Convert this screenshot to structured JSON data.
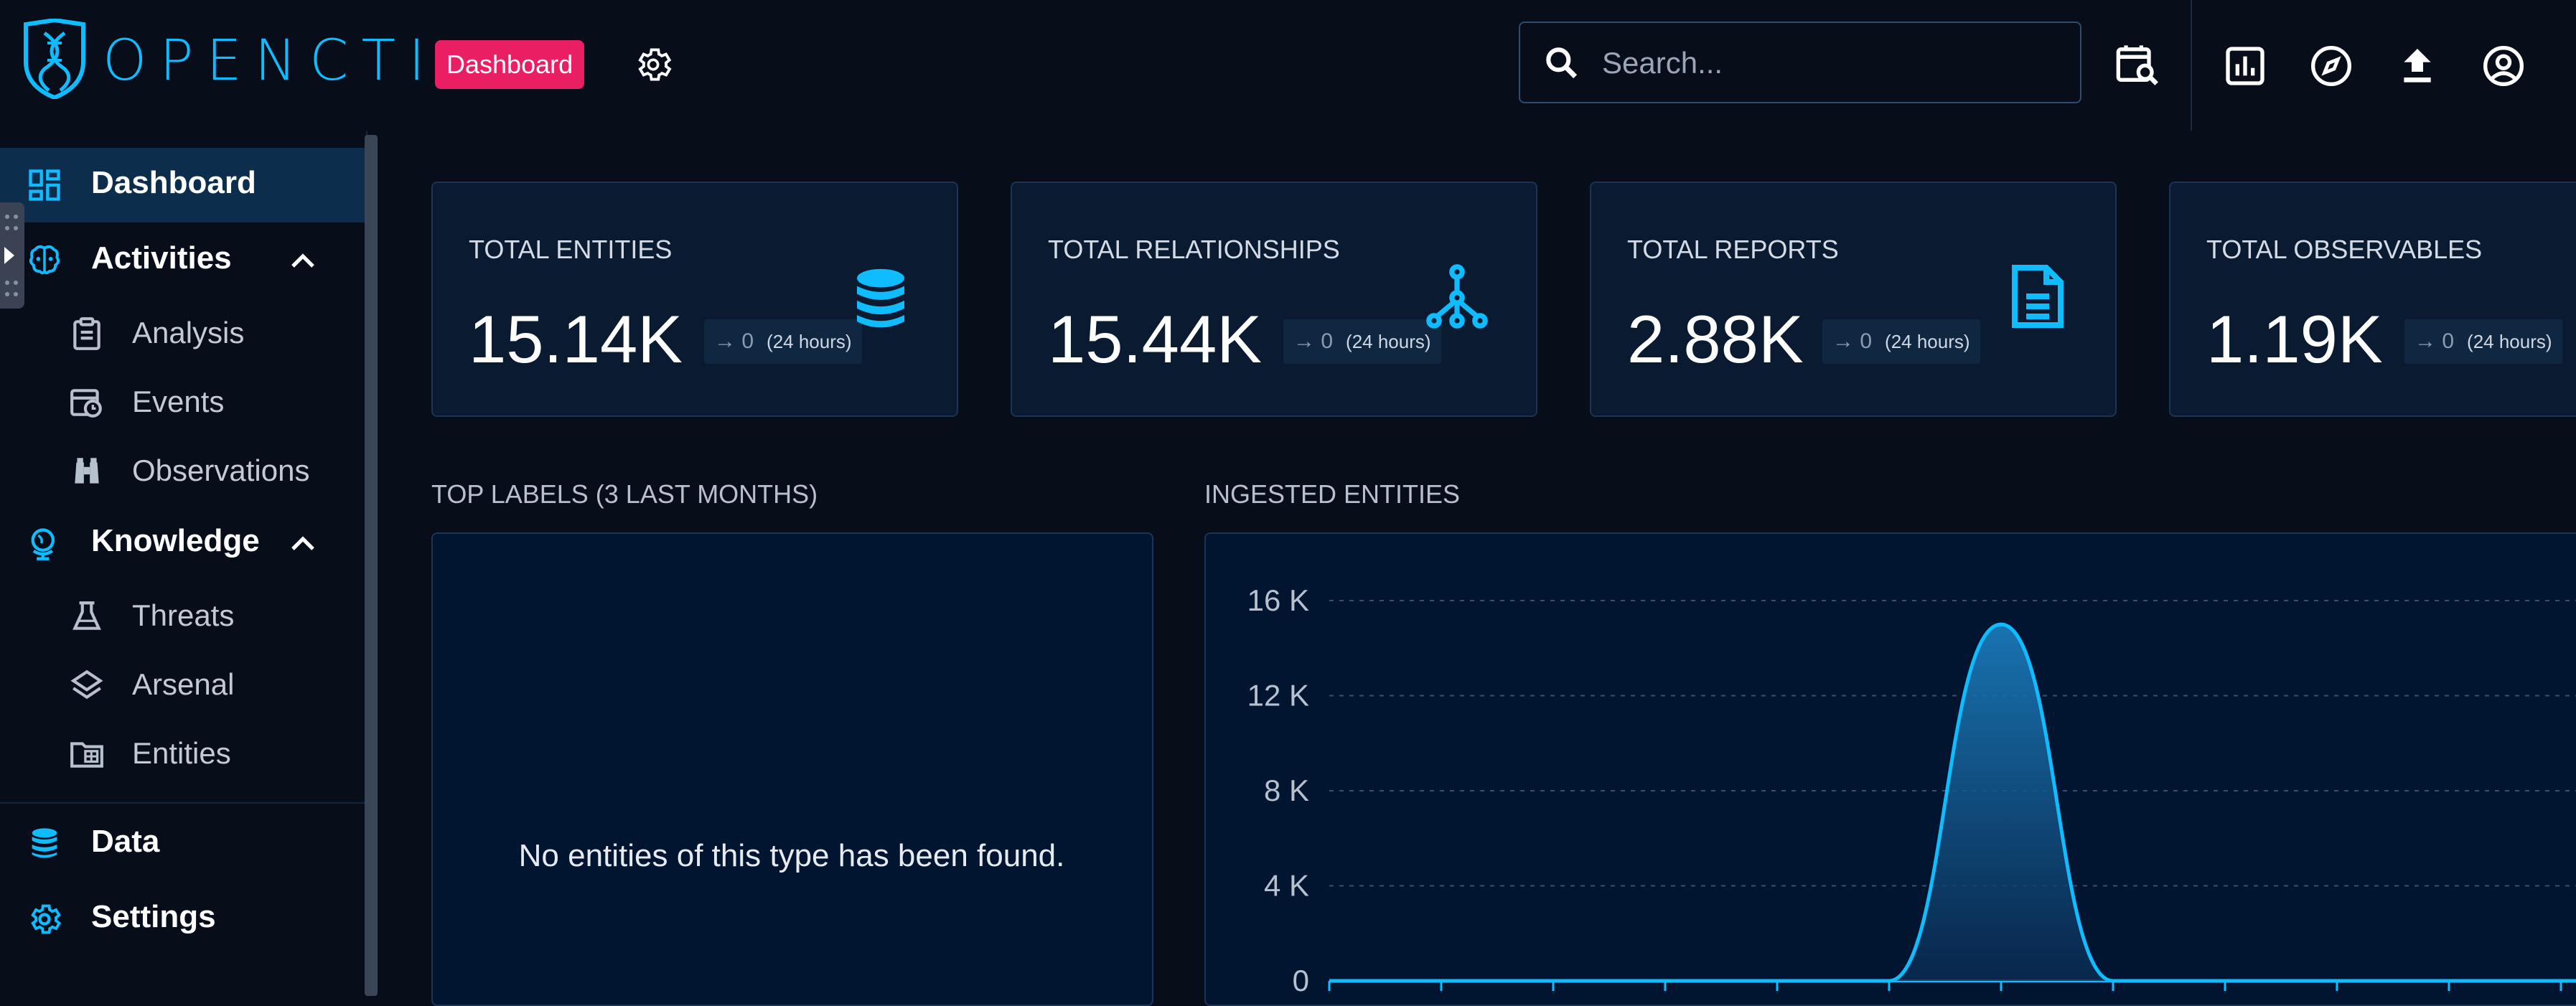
{
  "app": {
    "name": "OPENCTI"
  },
  "header": {
    "page_badge": "Dashboard",
    "search": {
      "placeholder": "Search...",
      "value": ""
    },
    "icons": [
      "settings-icon",
      "search-icon",
      "calendar-search-icon",
      "chart-box-icon",
      "compass-icon",
      "upload-icon",
      "account-icon"
    ]
  },
  "sidebar": {
    "items": [
      {
        "label": "Dashboard",
        "icon": "dashboard-icon",
        "active": true
      },
      {
        "label": "Activities",
        "icon": "brain-icon",
        "expanded": true
      },
      {
        "label": "Analysis",
        "icon": "clipboard-icon"
      },
      {
        "label": "Events",
        "icon": "calendar-clock-icon"
      },
      {
        "label": "Observations",
        "icon": "binoculars-icon"
      },
      {
        "label": "Knowledge",
        "icon": "globe-icon",
        "expanded": true
      },
      {
        "label": "Threats",
        "icon": "flask-icon"
      },
      {
        "label": "Arsenal",
        "icon": "layers-icon"
      },
      {
        "label": "Entities",
        "icon": "folder-table-icon"
      },
      {
        "label": "Data",
        "icon": "database-icon"
      },
      {
        "label": "Settings",
        "icon": "cog-icon"
      }
    ]
  },
  "cards": [
    {
      "title": "TOTAL ENTITIES",
      "value": "15.14K",
      "delta": "0",
      "period": "(24 hours)",
      "icon": "database-icon"
    },
    {
      "title": "TOTAL RELATIONSHIPS",
      "value": "15.44K",
      "delta": "0",
      "period": "(24 hours)",
      "icon": "graph-outline-icon"
    },
    {
      "title": "TOTAL REPORTS",
      "value": "2.88K",
      "delta": "0",
      "period": "(24 hours)",
      "icon": "file-document-icon"
    },
    {
      "title": "TOTAL OBSERVABLES",
      "value": "1.19K",
      "delta": "0",
      "period": "(24 hours)",
      "icon": "hexagon-icon"
    }
  ],
  "top_labels": {
    "title": "TOP LABELS (3 LAST MONTHS)",
    "empty_message": "No entities of this type has been found."
  },
  "ingested": {
    "title": "INGESTED ENTITIES"
  },
  "colors": {
    "accent": "#0fbcff",
    "badge": "#e91e63",
    "background": "#070d19",
    "panel": "#0a1a30"
  },
  "chart_data": {
    "type": "area",
    "title": "INGESTED ENTITIES",
    "xlabel": "",
    "ylabel": "",
    "yticks": [
      "16 K",
      "12 K",
      "8 K",
      "4 K",
      "0"
    ],
    "ylim": [
      0,
      16000
    ],
    "x": [
      0,
      1,
      2,
      3,
      4,
      5,
      6,
      7,
      8,
      9,
      10,
      11,
      12
    ],
    "series": [
      {
        "values": [
          0,
          0,
          0,
          0,
          0,
          0,
          15000,
          0,
          0,
          0,
          0,
          0,
          0
        ]
      }
    ],
    "grid": true
  }
}
